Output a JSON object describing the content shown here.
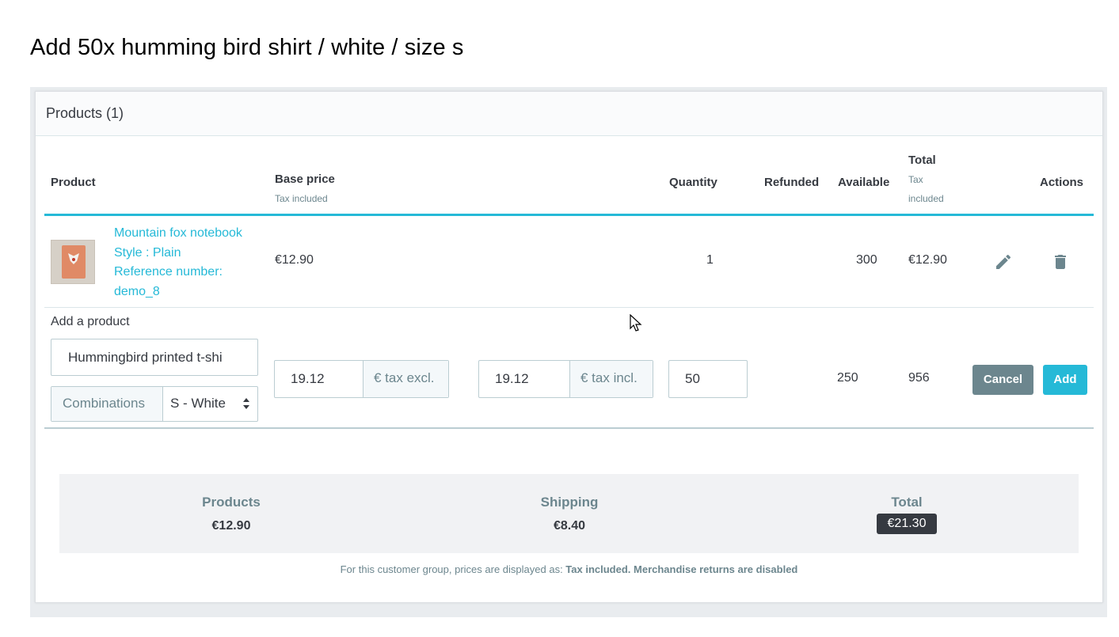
{
  "heading": "Add 50x humming bird shirt / white / size s",
  "card": {
    "title": "Products (1)"
  },
  "columns": {
    "product": "Product",
    "base_price": "Base price",
    "base_price_sub": "Tax included",
    "quantity": "Quantity",
    "refunded": "Refunded",
    "available": "Available",
    "total": "Total",
    "total_sub_1": "Tax",
    "total_sub_2": "included",
    "actions": "Actions"
  },
  "rows": [
    {
      "name": "Mountain fox notebook",
      "style": "Style : Plain",
      "ref_label": "Reference number:",
      "ref": "demo_8",
      "base_price": "€12.90",
      "quantity": "1",
      "refunded": "",
      "available": "300",
      "total": "€12.90",
      "edit_icon": "pencil-icon",
      "delete_icon": "trash-icon"
    }
  ],
  "add_product": {
    "label": "Add a product",
    "search_value": "Hummingbird printed t-shi",
    "combinations_label": "Combinations",
    "combination_selected": "S - White",
    "price_tax_excl": "19.12",
    "tax_excl_addon": "€ tax excl.",
    "price_tax_incl": "19.12",
    "tax_incl_addon": "€ tax incl.",
    "quantity": "50",
    "available": "250",
    "total": "956",
    "cancel_label": "Cancel",
    "add_label": "Add"
  },
  "summary": {
    "products_label": "Products",
    "products_value": "€12.90",
    "shipping_label": "Shipping",
    "shipping_value": "€8.40",
    "total_label": "Total",
    "total_value": "€21.30"
  },
  "footnote_prefix": "For this customer group, prices are displayed as: ",
  "footnote_bold": "Tax included. Merchandise returns are disabled",
  "colors": {
    "accent": "#25b9d7",
    "secondary": "#6c868e",
    "dark": "#363a41"
  }
}
